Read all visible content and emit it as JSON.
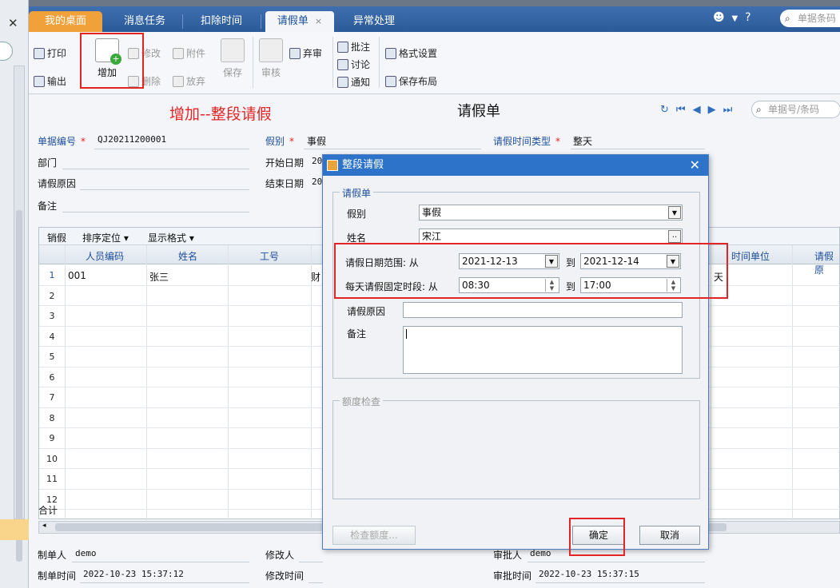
{
  "tabs": [
    {
      "label": "我的桌面"
    },
    {
      "label": "消息任务"
    },
    {
      "label": "扣除时间"
    },
    {
      "label": "请假单",
      "close": "×"
    },
    {
      "label": "异常处理"
    }
  ],
  "top_search_placeholder": "单据条码",
  "toolbar": {
    "print": "打印",
    "export": "输出",
    "add": "增加",
    "edit": "修改",
    "attach": "附件",
    "delete": "删除",
    "discard": "放弃",
    "save": "保存",
    "audit": "审核",
    "abandon": "弃审",
    "annotate": "批注",
    "discuss": "讨论",
    "notify": "通知",
    "format": "格式设置",
    "save_layout": "保存布局"
  },
  "annotation_title": "增加--整段请假",
  "form_title": "请假单",
  "nav_search_placeholder": "单据号/条码",
  "header_fields": {
    "doc_no_label": "单据编号",
    "doc_no": "QJ20211200001",
    "leave_type_label": "假别",
    "leave_type": "事假",
    "time_type_label": "请假时间类型",
    "time_type": "整天",
    "dept_label": "部门",
    "start_label": "开始日期",
    "start_val": "20",
    "reason_label": "请假原因",
    "end_label": "结束日期",
    "end_val": "20",
    "note_label": "备注"
  },
  "grid": {
    "toolbar": [
      "销假",
      "排序定位 ▾",
      "显示格式 ▾"
    ],
    "columns": [
      "人员编码",
      "姓名",
      "工号",
      "时间单位",
      "请假原"
    ],
    "rows": [
      {
        "n": "1",
        "code": "001",
        "name": "张三",
        "col4": "财",
        "unit": "天"
      },
      {
        "n": "2"
      },
      {
        "n": "3"
      },
      {
        "n": "4"
      },
      {
        "n": "5"
      },
      {
        "n": "6"
      },
      {
        "n": "7"
      },
      {
        "n": "8"
      },
      {
        "n": "9"
      },
      {
        "n": "10"
      },
      {
        "n": "11"
      },
      {
        "n": "12"
      }
    ],
    "total": "合计"
  },
  "dialog": {
    "title": "整段请假",
    "group1": "请假单",
    "type_label": "假别",
    "type_val": "事假",
    "name_label": "姓名",
    "name_val": "宋江",
    "name_btn": "..",
    "date_label": "请假日期范围: 从",
    "date_from": "2021-12-13",
    "to": "到",
    "date_to": "2021-12-14",
    "time_label": "每天请假固定时段: 从",
    "time_from": "08:30",
    "time_to": "17:00",
    "reason_label": "请假原因",
    "note_label": "备注",
    "group2": "额度检查",
    "check_btn": "检查额度...",
    "ok_btn": "确定",
    "cancel_btn": "取消"
  },
  "footer": {
    "maker_label": "制单人",
    "maker": "demo",
    "modifier_label": "修改人",
    "approver_label": "审批人",
    "approver": "demo",
    "make_time_label": "制单时间",
    "make_time": "2022-10-23 15:37:12",
    "mod_time_label": "修改时间",
    "approve_time_label": "审批时间",
    "approve_time": "2022-10-23 15:37:15"
  }
}
